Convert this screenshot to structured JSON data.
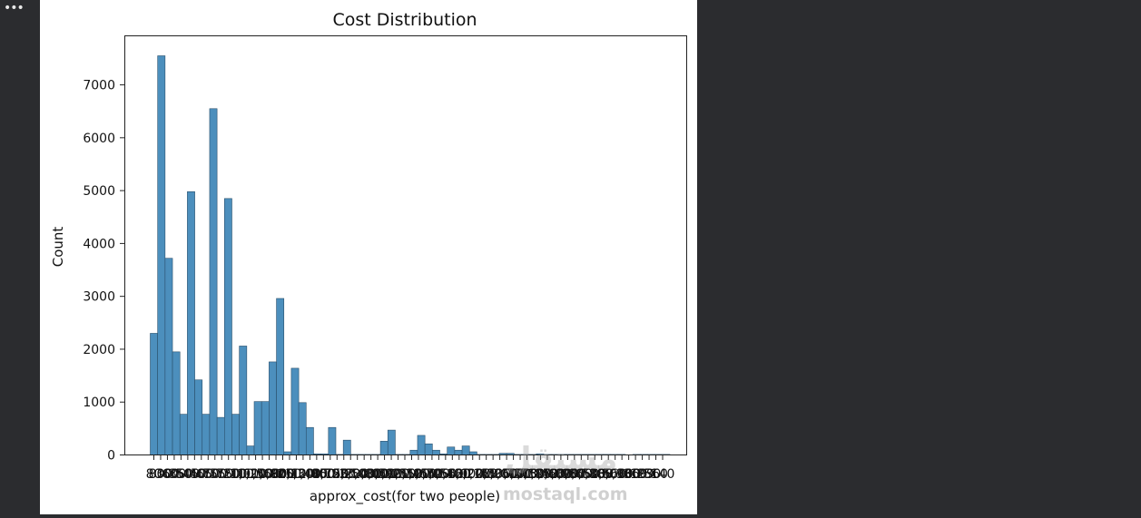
{
  "toolbar": {
    "more_icon": "more-horizontal-icon",
    "more_glyph": "•••"
  },
  "watermark": {
    "logo_text": "مستقل",
    "site_text": "mostaql.com"
  },
  "colors": {
    "bar_fill": "#4c8fbd",
    "bar_edge": "#2a4f6b",
    "panel_bg": "#2b2c2f"
  },
  "chart_data": {
    "type": "bar",
    "title": "Cost Distribution",
    "xlabel": "approx_cost(for two people)",
    "ylabel": "Count",
    "ylim": [
      0,
      7800
    ],
    "yticks": [
      0,
      1000,
      2000,
      3000,
      4000,
      5000,
      6000,
      7000
    ],
    "ytick_labels": [
      "0",
      "1000",
      "2000",
      "3000",
      "4000",
      "5000",
      "6000",
      "7000"
    ],
    "grid": false,
    "legend": false,
    "values": [
      2300,
      7550,
      3720,
      1950,
      770,
      4980,
      1420,
      770,
      6550,
      710,
      4850,
      770,
      2060,
      170,
      1010,
      1010,
      1760,
      2960,
      60,
      1640,
      990,
      520,
      20,
      20,
      520,
      10,
      280,
      10,
      10,
      10,
      10,
      260,
      470,
      10,
      10,
      90,
      370,
      210,
      90,
      20,
      150,
      90,
      170,
      60,
      10,
      10,
      10,
      30,
      30,
      10,
      10,
      10,
      20,
      10,
      10,
      10,
      10,
      10,
      10,
      10,
      10,
      10,
      10,
      10,
      0,
      10,
      10,
      10,
      10,
      10
    ],
    "xtick_labels": [
      "80",
      "800",
      "300",
      "600",
      "350",
      "500",
      "450",
      "400",
      "650",
      "700",
      "550",
      "750",
      "200",
      "100",
      "1,000",
      "1,200",
      "1,500",
      "1,600",
      "1,800",
      "900",
      "250",
      "1,100",
      "1,300",
      "1,400",
      "2,000",
      "850",
      "1,700",
      "150",
      "950",
      "2,200",
      "2,500",
      "3,000",
      "2,800",
      "4,000",
      "3,500",
      "1,900",
      "1,250",
      "1,350",
      "2,100",
      "1,450",
      "1,650",
      "2,700",
      "1,050",
      "4,500",
      "2,400",
      "120",
      "6,000",
      "3,200",
      "1,150",
      "40",
      "2,300",
      "1,950",
      "5,000",
      "3,700",
      "6,500",
      "1,750",
      "4,100",
      "1,850",
      "3,400",
      "2,600",
      "7,000",
      "2,900",
      "3,800",
      "2,650",
      "5,500",
      "4,800",
      "330",
      "1,560",
      "8,000",
      "5,900",
      "180",
      "360",
      "199",
      "230",
      "560",
      "140"
    ]
  }
}
